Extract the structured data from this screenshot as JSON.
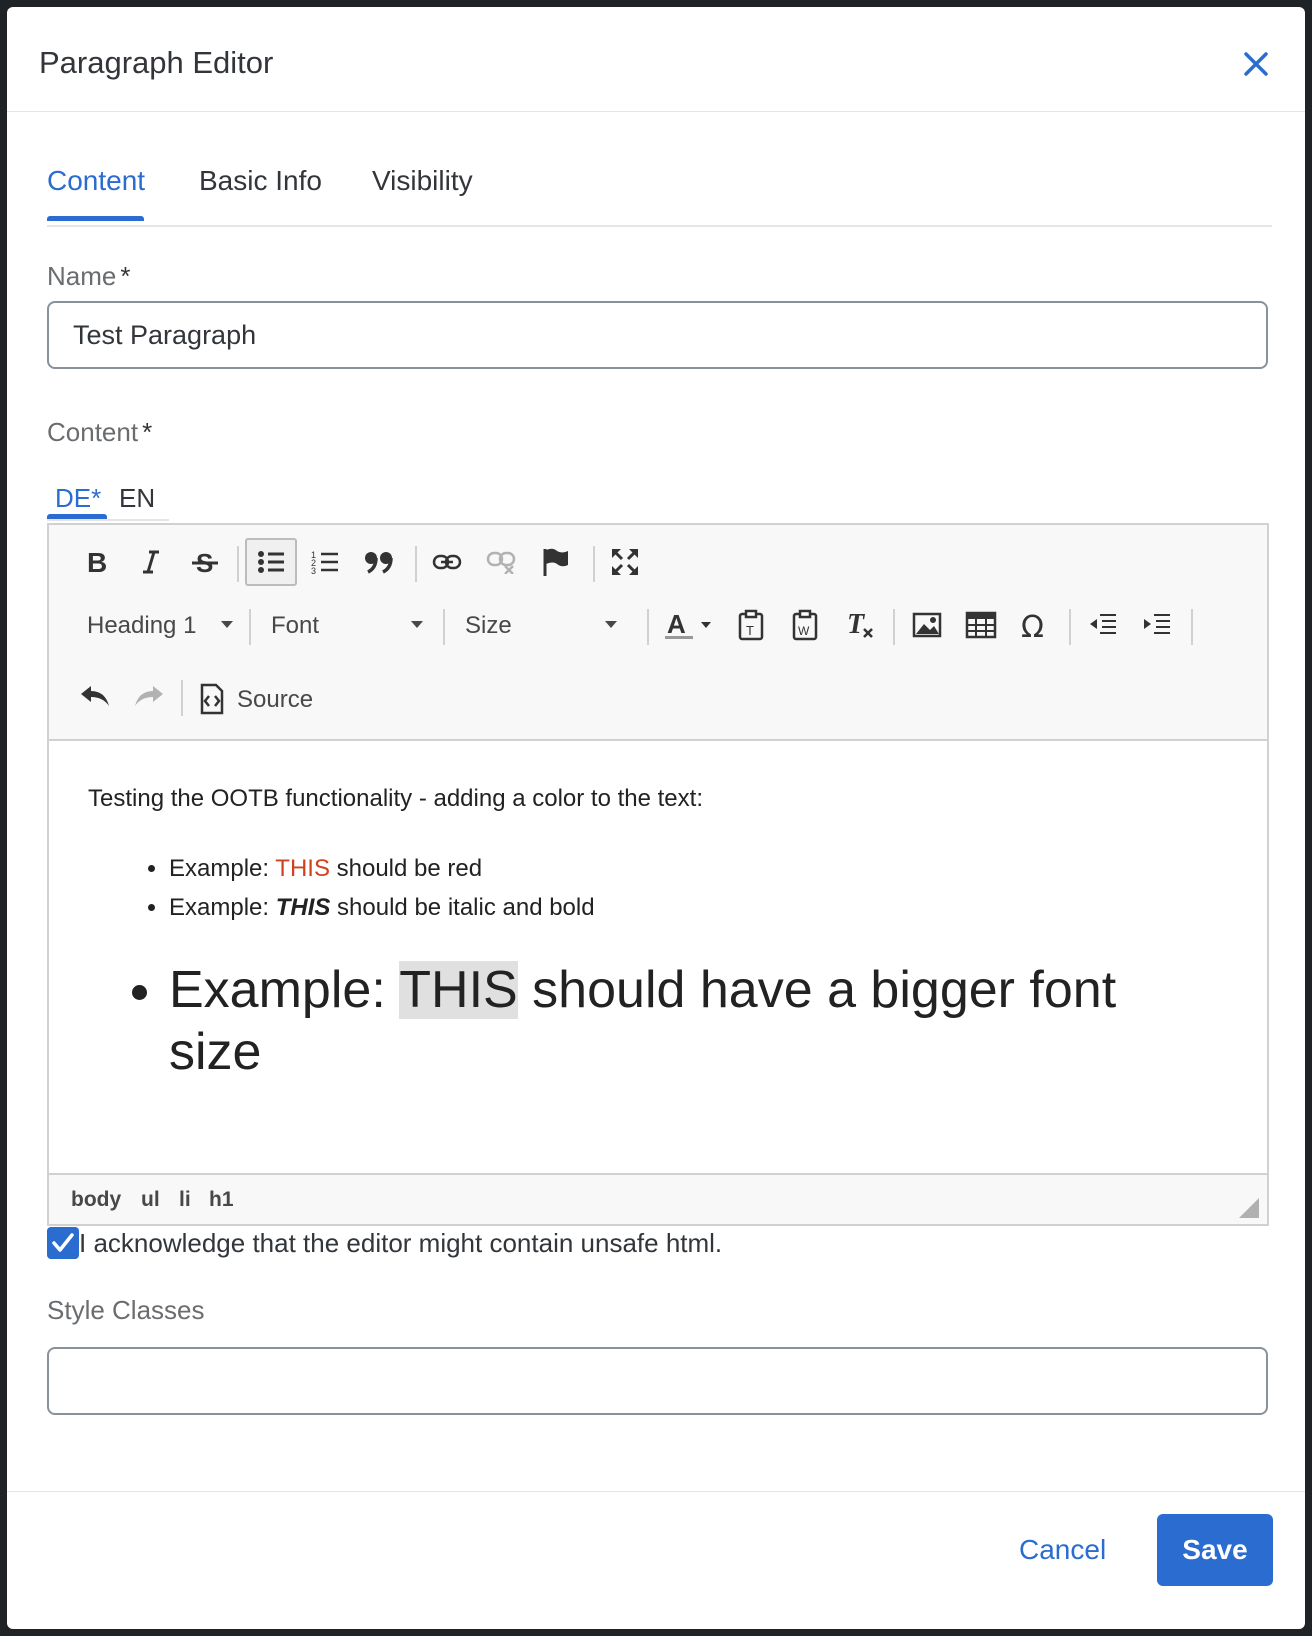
{
  "dialog": {
    "title": "Paragraph Editor"
  },
  "tabs": [
    {
      "label": "Content",
      "active": true
    },
    {
      "label": "Basic Info",
      "active": false
    },
    {
      "label": "Visibility",
      "active": false
    }
  ],
  "name_field": {
    "label": "Name",
    "required_mark": "*",
    "value": "Test Paragraph"
  },
  "content_field": {
    "label": "Content",
    "required_mark": "*"
  },
  "language_tabs": [
    {
      "label": "DE*",
      "active": true
    },
    {
      "label": "EN",
      "active": false
    }
  ],
  "editor": {
    "toolbar": {
      "heading_select": "Heading 1",
      "font_select": "Font",
      "size_select": "Size",
      "source_label": "Source"
    },
    "content": {
      "intro": "Testing the OOTB functionality - adding a color to the text:",
      "item1_prefix": "Example: ",
      "item1_highlight": "THIS",
      "item1_suffix": " should be red",
      "item2_prefix": "Example: ",
      "item2_highlight": "THIS",
      "item2_suffix": " should be italic and bold",
      "item3_prefix": "Example: ",
      "item3_highlight": "THIS",
      "item3_suffix": " should have a bigger font size"
    },
    "element_path": [
      "body",
      "ul",
      "li",
      "h1"
    ]
  },
  "acknowledge": {
    "label": "I acknowledge that the editor might contain unsafe html.",
    "checked": true
  },
  "style_classes": {
    "label": "Style Classes",
    "value": ""
  },
  "footer": {
    "cancel_label": "Cancel",
    "save_label": "Save"
  },
  "colors": {
    "accent": "#2a6ccf",
    "red_text": "#d0411f"
  }
}
